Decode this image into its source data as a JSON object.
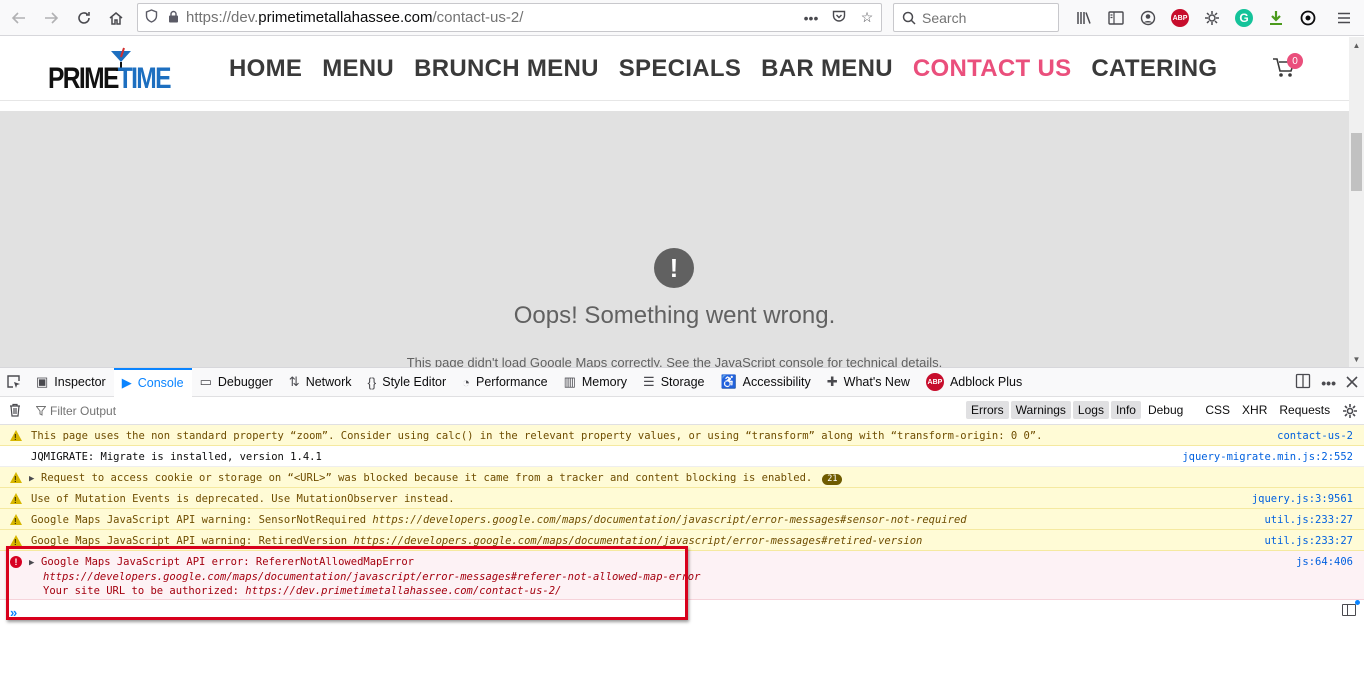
{
  "browser": {
    "url_prefix": "https://dev.",
    "url_host": "primetimetallahassee.com",
    "url_path": "/contact-us-2/",
    "search_placeholder": "Search",
    "abp_label": "ABP",
    "grammarly_label": "G"
  },
  "site": {
    "logo_prime": "PRIME",
    "logo_time": "TIME",
    "nav": [
      "HOME",
      "MENU",
      "BRUNCH MENU",
      "SPECIALS",
      "BAR MENU",
      "CONTACT US",
      "CATERING"
    ],
    "active_nav": "CONTACT US",
    "cart_count": "0",
    "map_error_icon": "!",
    "map_error_title": "Oops! Something went wrong.",
    "map_error_subtitle": "This page didn't load Google Maps correctly. See the JavaScript console for technical details."
  },
  "devtools": {
    "tabs": [
      {
        "label": "Inspector",
        "icon": "inspector-icon"
      },
      {
        "label": "Console",
        "icon": "console-icon"
      },
      {
        "label": "Debugger",
        "icon": "debugger-icon"
      },
      {
        "label": "Network",
        "icon": "network-icon"
      },
      {
        "label": "Style Editor",
        "icon": "style-editor-icon"
      },
      {
        "label": "Performance",
        "icon": "performance-icon"
      },
      {
        "label": "Memory",
        "icon": "memory-icon"
      },
      {
        "label": "Storage",
        "icon": "storage-icon"
      },
      {
        "label": "Accessibility",
        "icon": "accessibility-icon"
      },
      {
        "label": "What's New",
        "icon": "whats-new-icon"
      },
      {
        "label": "Adblock Plus",
        "icon": "adblock-icon"
      }
    ],
    "active_tab": "Console",
    "filter_placeholder": "Filter Output",
    "filters": [
      "Errors",
      "Warnings",
      "Logs",
      "Info",
      "Debug"
    ],
    "filters_on": [
      "Errors",
      "Warnings",
      "Logs",
      "Info"
    ],
    "filters_extra": [
      "CSS",
      "XHR",
      "Requests"
    ],
    "messages": [
      {
        "level": "warn",
        "text": "This page uses the non standard property “zoom”. Consider using calc() in the relevant property values, or using “transform” along with “transform-origin: 0 0”.",
        "source": "contact-us-2"
      },
      {
        "level": "log",
        "text": "JQMIGRATE: Migrate is installed, version 1.4.1",
        "source": "jquery-migrate.min.js:2:552"
      },
      {
        "level": "warn",
        "expandable": true,
        "text": "Request to access cookie or storage on “<URL>” was blocked because it came from a tracker and content blocking is enabled.",
        "count": "21",
        "source": ""
      },
      {
        "level": "warn",
        "text": "Use of Mutation Events is deprecated. Use MutationObserver instead.",
        "source": "jquery.js:3:9561"
      },
      {
        "level": "warn",
        "text": "Google Maps JavaScript API warning: SensorNotRequired ",
        "link": "https://developers.google.com/maps/documentation/javascript/error-messages#sensor-not-required",
        "source": "util.js:233:27"
      },
      {
        "level": "warn",
        "text": "Google Maps JavaScript API warning: RetiredVersion ",
        "link": "https://developers.google.com/maps/documentation/javascript/error-messages#retired-version",
        "source": "util.js:233:27"
      }
    ],
    "error": {
      "line1": "Google Maps JavaScript API error: RefererNotAllowedMapError",
      "line2": "https://developers.google.com/maps/documentation/javascript/error-messages#referer-not-allowed-map-error",
      "line3_prefix": "Your site URL to be authorized: ",
      "line3_url": "https://dev.primetimetallahassee.com/contact-us-2/",
      "source": "js:64:406"
    },
    "prompt": "»"
  }
}
